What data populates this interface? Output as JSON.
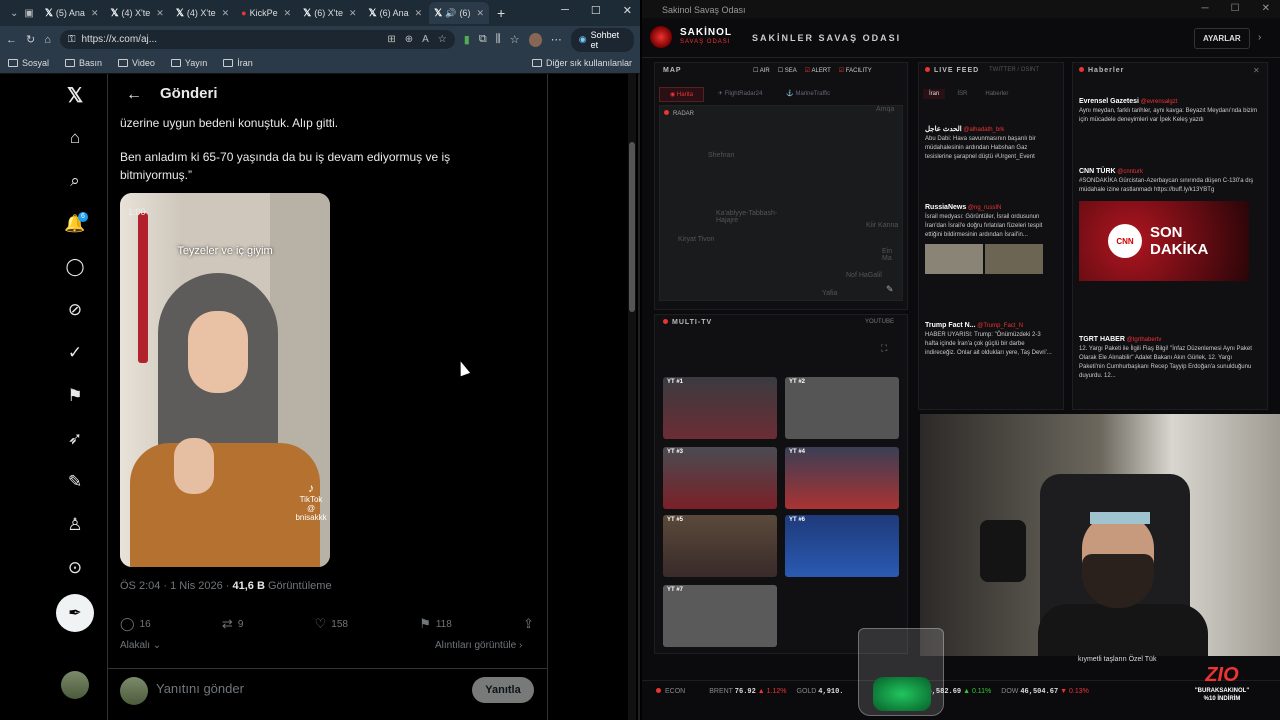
{
  "browser": {
    "tabs": [
      "(5) Ana",
      "(4) X'te",
      "(4) X'te",
      "KickPe",
      "(6) X'te",
      "(6) Ana",
      "(6)"
    ],
    "url": "https://x.com/aj...",
    "copilot_label": "Sohbet et",
    "bookmarks": [
      "Sosyal",
      "Basın",
      "Video",
      "Yayın",
      "İran"
    ],
    "other_bookmarks": "Diğer sık kullanılanlar"
  },
  "x": {
    "notif_count": "6",
    "page_title": "Gönderi",
    "text_line1": "üzerine uygun bedeni konuştuk. Alıp gitti.",
    "text_line2": "Ben anladım ki 65-70 yaşında da bu iş devam ediyormuş ve iş bitmiyormuş.”",
    "video_time": "1:00",
    "video_caption": "Teyzeler ve iç giyim",
    "video_watermark": "TikTok",
    "video_handle": "@ bnisakkk",
    "meta_time": "ÖS 2:04 · 1 Nis 2026 · ",
    "meta_views": "41,6 B",
    "meta_views_label": " Görüntüleme",
    "replies": "16",
    "reposts": "9",
    "likes": "158",
    "bookmarks": "118",
    "related": "Alakalı",
    "quotes": "Alıntıları görüntüle",
    "reply_placeholder": "Yanıtını gönder",
    "reply_button": "Yanıtla"
  },
  "app": {
    "window_title": "Sakinol Savaş Odası",
    "brand": "SAKİNOL",
    "brand_sub": "SAVAŞ ODASI",
    "title": "SAKİNLER SAVAŞ ODASI",
    "settings": "AYARLAR",
    "map_title": "MAP",
    "map_filters": [
      "AIR",
      "SEA",
      "ALERT",
      "FACILITY"
    ],
    "map_tabs": [
      "Harita",
      "FlightRadar24",
      "MarineTraffic"
    ],
    "map_radar": "RADAR",
    "map_labels": [
      "Shehran",
      "Ka'ablyye-Tabbash-Hajajre",
      "Kiryat Tivon",
      "Kiir Kanna",
      "Ein Ma",
      "Nof HaGalil",
      "Yafia",
      "Amqa"
    ],
    "live_feed": "LIVE FEED",
    "live_feed_sub": "TWITTER / OSINT",
    "live_tabs": [
      "İran",
      "İSR",
      "Haberler"
    ],
    "live_items": [
      {
        "src": "الحدث عاجل",
        "handle": "@alhadath_brk",
        "text": "Abu Dabi: Hava savunmasının başarılı bir müdahalesinin ardından Habshan Gaz tesislerine şarapnel düştü #Urgent_Event"
      },
      {
        "src": "RussiaNews",
        "handle": "@ng_russIN",
        "text": "İsrail medyası: Görüntüler, İsrail ordusunun İran'dan İsrail'e doğru fırlatılan füzeleri tespit ettiğini bildirmesinin ardından İsrail'in..."
      },
      {
        "src": "Trump Fact N...",
        "handle": "@Trump_Fact_N",
        "text": "HABER UYARISI: Trump: \"Önümüzdeki 2-3 hafta içinde İran'a çok güçlü bir darbe indireceğiz. Onlar ait oldukları yere, Taş Devri'..."
      }
    ],
    "news_title": "Haberler",
    "news_items": [
      {
        "src": "Evrensel Gazetesi",
        "handle": "@evrensalgzt",
        "text": "Aynı meydan, farklı tarihler, aynı kavga: Beyazıt Meydanı'nda bizim için mücadele deneyimleri var İpek Keleş yazdı"
      },
      {
        "src": "CNN TÜRK",
        "handle": "@cnnturk",
        "text": "#SONDAKİKA Gürcistan-Azerbaycan sınırında düşen C-130'a dış müdahale izine rastlanmadı https://buff.ly/k13YBTg"
      },
      {
        "src": "TGRT HABER",
        "handle": "@tgrthabertv",
        "text": "12. Yargı Paketi ile İlgili Flaş Bilgi! \"İnfaz Düzenlemesi Aynı Paket Olarak Ele Alınabilir\" Adalet Bakanı Akın Gürlek, 12. Yargı Paketi'nin Cumhurbaşkanı Recep Tayyip Erdoğan'a sunulduğunu duyurdu. 12..."
      }
    ],
    "son_dakika": "SON DAKİKA",
    "multitv": "MULTI-TV",
    "youtube": "YOUTUBE",
    "tv_labels": [
      "YT #1",
      "YT #2",
      "YT #3",
      "YT #4",
      "YT #5",
      "YT #6",
      "YT #7"
    ],
    "ticker": [
      {
        "label": "ECON",
        "value": ""
      },
      {
        "label": "BRENT",
        "value": "76.92",
        "change": "▲ 1.12%"
      },
      {
        "label": "GOLD",
        "value": "4,910.",
        "change": ""
      },
      {
        "label": "",
        "value": "6,582.69",
        "change": "▲ 0.11%"
      },
      {
        "label": "DOW",
        "value": "46,504.67",
        "change": "▼ 0.13%"
      }
    ],
    "cam_caption": "kıymetli taşların Özel Tük",
    "zio": "ZIO",
    "zio_text1": "\"BURAKSAKINOL\"",
    "zio_text2": "%10 İNDİRİM"
  },
  "colors": {
    "accent_x": "#1d9bf0",
    "alert_red": "#e33"
  }
}
